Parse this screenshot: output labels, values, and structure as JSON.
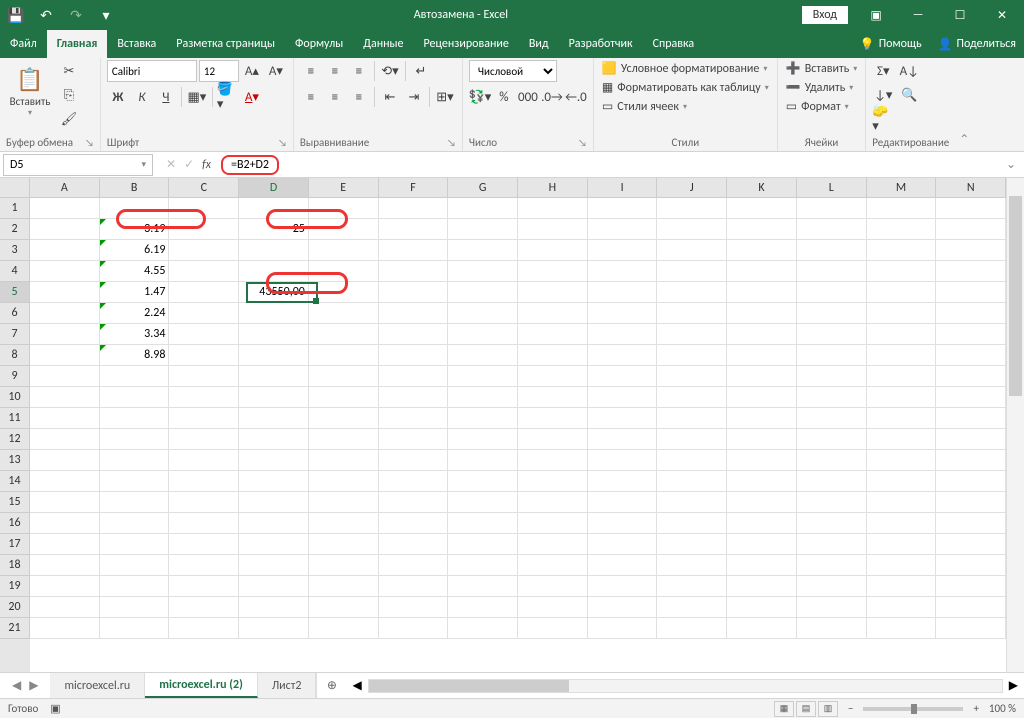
{
  "title": "Автозамена - Excel",
  "signin": "Вход",
  "tabs": {
    "file": "Файл",
    "home": "Главная",
    "insert": "Вставка",
    "layout": "Разметка страницы",
    "formulas": "Формулы",
    "data": "Данные",
    "review": "Рецензирование",
    "view": "Вид",
    "developer": "Разработчик",
    "help": "Справка",
    "assist": "Помощь",
    "share": "Поделиться"
  },
  "ribbon": {
    "clipboard": {
      "paste": "Вставить",
      "label": "Буфер обмена"
    },
    "font": {
      "name": "Calibri",
      "size": "12",
      "label": "Шрифт",
      "bold": "Ж",
      "italic": "К",
      "underline": "Ч"
    },
    "align": {
      "label": "Выравнивание"
    },
    "number": {
      "format": "Числовой",
      "label": "Число"
    },
    "styles": {
      "cond": "Условное форматирование",
      "table": "Форматировать как таблицу",
      "cell": "Стили ячеек",
      "label": "Стили"
    },
    "cells": {
      "insert": "Вставить",
      "delete": "Удалить",
      "format": "Формат",
      "label": "Ячейки"
    },
    "editing": {
      "label": "Редактирование"
    }
  },
  "formula": {
    "cell_ref": "D5",
    "value": "=B2+D2"
  },
  "columns": [
    "A",
    "B",
    "C",
    "D",
    "E",
    "F",
    "G",
    "H",
    "I",
    "J",
    "K",
    "L",
    "M",
    "N"
  ],
  "rows": [
    "1",
    "2",
    "3",
    "4",
    "5",
    "6",
    "7",
    "8",
    "9",
    "10",
    "11",
    "12",
    "13",
    "14",
    "15",
    "16",
    "17",
    "18",
    "19",
    "20",
    "21"
  ],
  "active_col": "D",
  "active_row": "5",
  "cells": {
    "B2": "3.19",
    "B3": "6.19",
    "B4": "4.55",
    "B5": "1.47",
    "B6": "2.24",
    "B7": "3.34",
    "B8": "8.98",
    "D2": "25",
    "D5": "43550,00"
  },
  "sheets": {
    "s1": "microexcel.ru",
    "s2": "microexcel.ru (2)",
    "s3": "Лист2"
  },
  "status": {
    "ready": "Готово",
    "zoom": "100 %"
  }
}
